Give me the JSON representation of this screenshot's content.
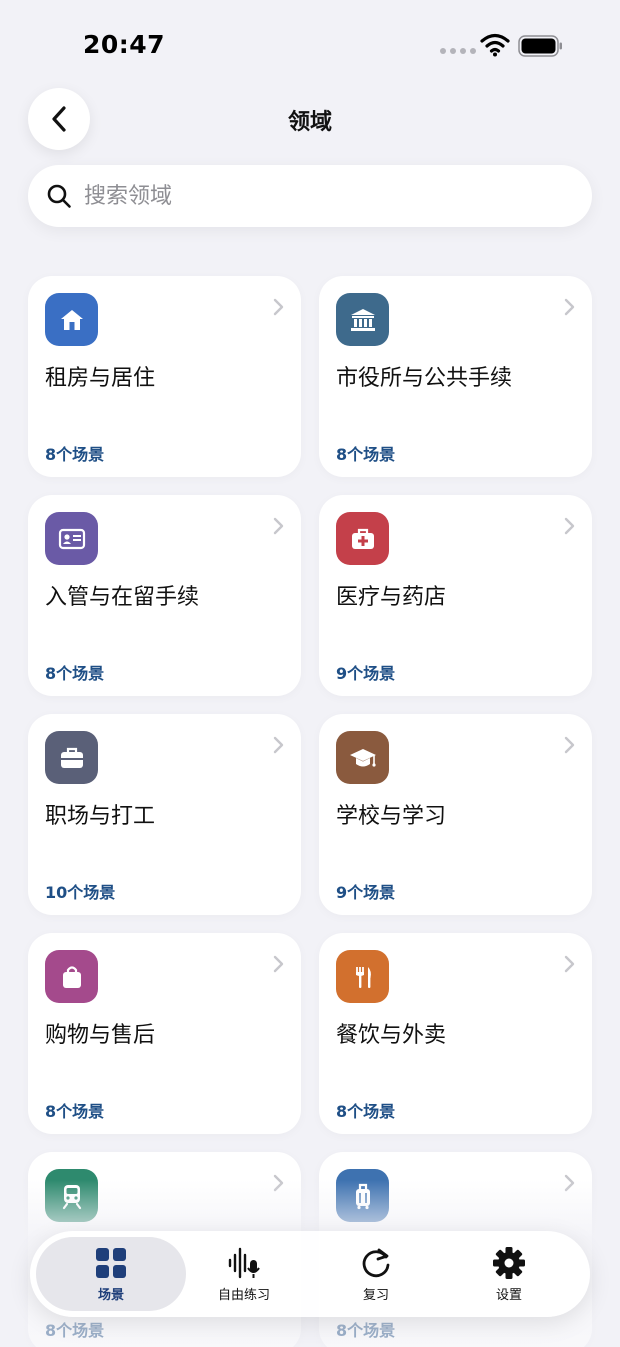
{
  "status_bar": {
    "time": "20:47"
  },
  "header": {
    "title": "领域"
  },
  "search": {
    "placeholder": "搜索领域"
  },
  "colors": {
    "accent": "#1f3f7a",
    "count_text": "#1f4f86",
    "background": "#f2f2f7"
  },
  "cards": [
    {
      "title": "租房与居住",
      "count": "8个场景",
      "icon": "house-icon",
      "color": "#3a6fc4"
    },
    {
      "title": "市役所与公共手续",
      "count": "8个场景",
      "icon": "government-building-icon",
      "color": "#3e6a8c"
    },
    {
      "title": "入管与在留手续",
      "count": "8个场景",
      "icon": "id-card-icon",
      "color": "#6a5aa6"
    },
    {
      "title": "医疗与药店",
      "count": "9个场景",
      "icon": "first-aid-kit-icon",
      "color": "#c4404a"
    },
    {
      "title": "职场与打工",
      "count": "10个场景",
      "icon": "briefcase-icon",
      "color": "#5a6078"
    },
    {
      "title": "学校与学习",
      "count": "9个场景",
      "icon": "graduation-cap-icon",
      "color": "#8a5a3e"
    },
    {
      "title": "购物与售后",
      "count": "8个场景",
      "icon": "shopping-bag-icon",
      "color": "#a44a8c"
    },
    {
      "title": "餐饮与外卖",
      "count": "8个场景",
      "icon": "fork-knife-icon",
      "color": "#d2702e"
    },
    {
      "title": "",
      "count": "8个场景",
      "icon": "train-icon",
      "color": "#2e8a6e"
    },
    {
      "title": "",
      "count": "8个场景",
      "icon": "luggage-icon",
      "color": "#3e72b0"
    }
  ],
  "tabs": [
    {
      "label": "场景",
      "icon": "grid-icon",
      "active": true
    },
    {
      "label": "自由练习",
      "icon": "microphone-waveform-icon",
      "active": false
    },
    {
      "label": "复习",
      "icon": "refresh-icon",
      "active": false
    },
    {
      "label": "设置",
      "icon": "gear-icon",
      "active": false
    }
  ]
}
